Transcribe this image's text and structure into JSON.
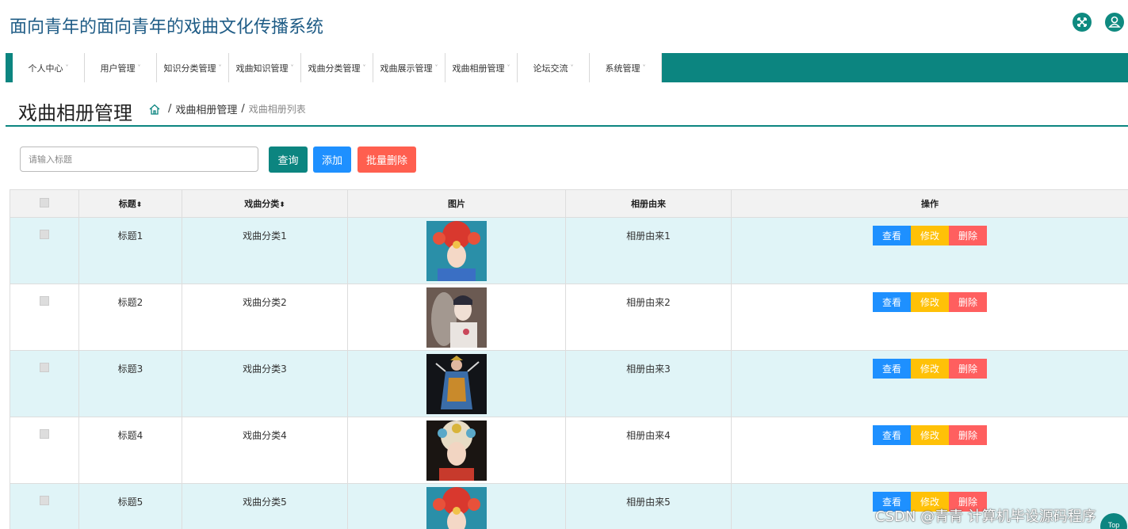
{
  "app": {
    "title": "面向青年的面向青年的戏曲文化传播系统",
    "fullscreen_icon": "fullscreen-icon",
    "user_icon": "user-icon"
  },
  "nav": {
    "items": [
      {
        "label": "个人中心"
      },
      {
        "label": "用户管理"
      },
      {
        "label": "知识分类管理"
      },
      {
        "label": "戏曲知识管理"
      },
      {
        "label": "戏曲分类管理"
      },
      {
        "label": "戏曲展示管理"
      },
      {
        "label": "戏曲相册管理"
      },
      {
        "label": "论坛交流"
      },
      {
        "label": "系统管理"
      }
    ],
    "caret": "˅",
    "color": "#0c8580"
  },
  "page": {
    "title": "戏曲相册管理",
    "breadcrumb": {
      "home_icon": "home-icon",
      "sep": "/",
      "parent": "戏曲相册管理",
      "current": "戏曲相册列表"
    }
  },
  "search": {
    "placeholder": "请输入标题",
    "query_label": "查询",
    "add_label": "添加",
    "batch_delete_label": "批量删除"
  },
  "table": {
    "columns": {
      "title": "标题",
      "category": "戏曲分类",
      "image": "图片",
      "source": "相册由来",
      "actions": "操作",
      "sort_icon": "⬍"
    },
    "rows": [
      {
        "title": "标题1",
        "category": "戏曲分类1",
        "source": "相册由来1"
      },
      {
        "title": "标题2",
        "category": "戏曲分类2",
        "source": "相册由来2"
      },
      {
        "title": "标题3",
        "category": "戏曲分类3",
        "source": "相册由来3"
      },
      {
        "title": "标题4",
        "category": "戏曲分类4",
        "source": "相册由来4"
      },
      {
        "title": "标题5",
        "category": "戏曲分类5",
        "source": "相册由来5"
      }
    ],
    "row_actions": {
      "view": "查看",
      "edit": "修改",
      "delete": "删除"
    }
  },
  "watermark": "CSDN @青青 计算机毕设源码程序",
  "back_to_top": "Top"
}
